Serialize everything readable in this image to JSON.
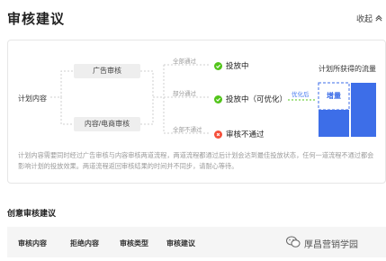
{
  "header": {
    "title": "审核建议",
    "collapse_label": "收起"
  },
  "flow": {
    "root_label": "计划内容",
    "review_nodes": [
      "广告审核",
      "内容/电商审核"
    ],
    "branches": [
      {
        "condition": "全部通过",
        "status": "投放中",
        "status_type": "ok"
      },
      {
        "condition": "部分通过",
        "status": "投放中（可优化）",
        "status_type": "ok"
      },
      {
        "condition": "全部不通过",
        "status": "审核不通过",
        "status_type": "fail"
      }
    ],
    "traffic_title": "计划所获得的流量",
    "optimize_label": "优化后",
    "increase_label": "增量"
  },
  "description": "计划内容需要同时经过广告审核与内容审核两道流程，两道流程都通过后计划会达到最佳投放状态，任何一道流程不通过都会影响计划的投放效果。两道流程返回审核结果的时间并不同步，请耐心等待。",
  "section": {
    "title": "创意审核建议",
    "columns": [
      "审核内容",
      "拒绝内容",
      "审核类型",
      "审核建议"
    ]
  },
  "watermark": "厚昌营销学园",
  "colors": {
    "accent": "#3d6ee8",
    "ok": "#52c41a",
    "fail": "#f5503b"
  }
}
